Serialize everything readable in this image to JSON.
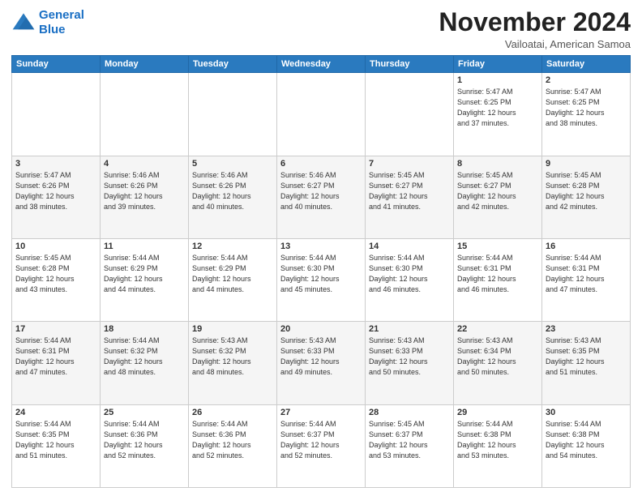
{
  "header": {
    "logo_line1": "General",
    "logo_line2": "Blue",
    "month": "November 2024",
    "location": "Vailoatai, American Samoa"
  },
  "weekdays": [
    "Sunday",
    "Monday",
    "Tuesday",
    "Wednesday",
    "Thursday",
    "Friday",
    "Saturday"
  ],
  "weeks": [
    [
      {
        "day": "",
        "info": ""
      },
      {
        "day": "",
        "info": ""
      },
      {
        "day": "",
        "info": ""
      },
      {
        "day": "",
        "info": ""
      },
      {
        "day": "",
        "info": ""
      },
      {
        "day": "1",
        "info": "Sunrise: 5:47 AM\nSunset: 6:25 PM\nDaylight: 12 hours\nand 37 minutes."
      },
      {
        "day": "2",
        "info": "Sunrise: 5:47 AM\nSunset: 6:25 PM\nDaylight: 12 hours\nand 38 minutes."
      }
    ],
    [
      {
        "day": "3",
        "info": "Sunrise: 5:47 AM\nSunset: 6:26 PM\nDaylight: 12 hours\nand 38 minutes."
      },
      {
        "day": "4",
        "info": "Sunrise: 5:46 AM\nSunset: 6:26 PM\nDaylight: 12 hours\nand 39 minutes."
      },
      {
        "day": "5",
        "info": "Sunrise: 5:46 AM\nSunset: 6:26 PM\nDaylight: 12 hours\nand 40 minutes."
      },
      {
        "day": "6",
        "info": "Sunrise: 5:46 AM\nSunset: 6:27 PM\nDaylight: 12 hours\nand 40 minutes."
      },
      {
        "day": "7",
        "info": "Sunrise: 5:45 AM\nSunset: 6:27 PM\nDaylight: 12 hours\nand 41 minutes."
      },
      {
        "day": "8",
        "info": "Sunrise: 5:45 AM\nSunset: 6:27 PM\nDaylight: 12 hours\nand 42 minutes."
      },
      {
        "day": "9",
        "info": "Sunrise: 5:45 AM\nSunset: 6:28 PM\nDaylight: 12 hours\nand 42 minutes."
      }
    ],
    [
      {
        "day": "10",
        "info": "Sunrise: 5:45 AM\nSunset: 6:28 PM\nDaylight: 12 hours\nand 43 minutes."
      },
      {
        "day": "11",
        "info": "Sunrise: 5:44 AM\nSunset: 6:29 PM\nDaylight: 12 hours\nand 44 minutes."
      },
      {
        "day": "12",
        "info": "Sunrise: 5:44 AM\nSunset: 6:29 PM\nDaylight: 12 hours\nand 44 minutes."
      },
      {
        "day": "13",
        "info": "Sunrise: 5:44 AM\nSunset: 6:30 PM\nDaylight: 12 hours\nand 45 minutes."
      },
      {
        "day": "14",
        "info": "Sunrise: 5:44 AM\nSunset: 6:30 PM\nDaylight: 12 hours\nand 46 minutes."
      },
      {
        "day": "15",
        "info": "Sunrise: 5:44 AM\nSunset: 6:31 PM\nDaylight: 12 hours\nand 46 minutes."
      },
      {
        "day": "16",
        "info": "Sunrise: 5:44 AM\nSunset: 6:31 PM\nDaylight: 12 hours\nand 47 minutes."
      }
    ],
    [
      {
        "day": "17",
        "info": "Sunrise: 5:44 AM\nSunset: 6:31 PM\nDaylight: 12 hours\nand 47 minutes."
      },
      {
        "day": "18",
        "info": "Sunrise: 5:44 AM\nSunset: 6:32 PM\nDaylight: 12 hours\nand 48 minutes."
      },
      {
        "day": "19",
        "info": "Sunrise: 5:43 AM\nSunset: 6:32 PM\nDaylight: 12 hours\nand 48 minutes."
      },
      {
        "day": "20",
        "info": "Sunrise: 5:43 AM\nSunset: 6:33 PM\nDaylight: 12 hours\nand 49 minutes."
      },
      {
        "day": "21",
        "info": "Sunrise: 5:43 AM\nSunset: 6:33 PM\nDaylight: 12 hours\nand 50 minutes."
      },
      {
        "day": "22",
        "info": "Sunrise: 5:43 AM\nSunset: 6:34 PM\nDaylight: 12 hours\nand 50 minutes."
      },
      {
        "day": "23",
        "info": "Sunrise: 5:43 AM\nSunset: 6:35 PM\nDaylight: 12 hours\nand 51 minutes."
      }
    ],
    [
      {
        "day": "24",
        "info": "Sunrise: 5:44 AM\nSunset: 6:35 PM\nDaylight: 12 hours\nand 51 minutes."
      },
      {
        "day": "25",
        "info": "Sunrise: 5:44 AM\nSunset: 6:36 PM\nDaylight: 12 hours\nand 52 minutes."
      },
      {
        "day": "26",
        "info": "Sunrise: 5:44 AM\nSunset: 6:36 PM\nDaylight: 12 hours\nand 52 minutes."
      },
      {
        "day": "27",
        "info": "Sunrise: 5:44 AM\nSunset: 6:37 PM\nDaylight: 12 hours\nand 52 minutes."
      },
      {
        "day": "28",
        "info": "Sunrise: 5:45 AM\nSunset: 6:37 PM\nDaylight: 12 hours\nand 53 minutes."
      },
      {
        "day": "29",
        "info": "Sunrise: 5:44 AM\nSunset: 6:38 PM\nDaylight: 12 hours\nand 53 minutes."
      },
      {
        "day": "30",
        "info": "Sunrise: 5:44 AM\nSunset: 6:38 PM\nDaylight: 12 hours\nand 54 minutes."
      }
    ]
  ]
}
